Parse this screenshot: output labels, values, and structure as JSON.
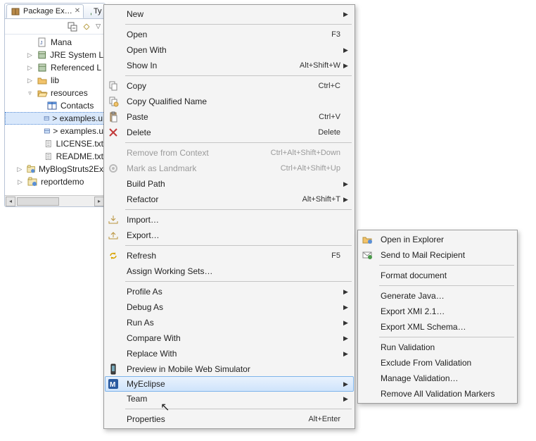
{
  "tabs": {
    "active": "Package Ex…",
    "inactive": "Type Hierar…"
  },
  "tree": {
    "items": [
      {
        "depth": 0,
        "twisty": "",
        "icon": "java-file",
        "label": "Mana"
      },
      {
        "depth": 0,
        "twisty": "▷",
        "icon": "jar",
        "label": "JRE System L"
      },
      {
        "depth": 0,
        "twisty": "▷",
        "icon": "jar",
        "label": "Referenced L"
      },
      {
        "depth": 0,
        "twisty": "▷",
        "icon": "folder",
        "label": "lib"
      },
      {
        "depth": 0,
        "twisty": "▿",
        "icon": "folder-open",
        "label": "resources"
      },
      {
        "depth": 1,
        "twisty": "",
        "icon": "table",
        "label": "Contacts"
      },
      {
        "depth": 1,
        "twisty": "",
        "icon": "uml",
        "label": "> examples.u",
        "selected": true
      },
      {
        "depth": 1,
        "twisty": "",
        "icon": "uml",
        "label": "> examples.u"
      },
      {
        "depth": 1,
        "twisty": "",
        "icon": "text",
        "label": "LICENSE.txt"
      },
      {
        "depth": 1,
        "twisty": "",
        "icon": "text",
        "label": "README.txt"
      },
      {
        "depth": -1,
        "twisty": "▷",
        "icon": "proj",
        "label": "MyBlogStruts2Ex"
      },
      {
        "depth": -1,
        "twisty": "▷",
        "icon": "proj",
        "label": "reportdemo"
      }
    ]
  },
  "menu": [
    {
      "type": "item",
      "label": "New",
      "arrow": true
    },
    {
      "type": "sep"
    },
    {
      "type": "item",
      "label": "Open",
      "shortcut": "F3"
    },
    {
      "type": "item",
      "label": "Open With",
      "arrow": true
    },
    {
      "type": "item",
      "label": "Show In",
      "shortcut": "Alt+Shift+W",
      "arrow": true
    },
    {
      "type": "sep"
    },
    {
      "type": "item",
      "icon": "copy",
      "label": "Copy",
      "shortcut": "Ctrl+C"
    },
    {
      "type": "item",
      "icon": "copy-q",
      "label": "Copy Qualified Name"
    },
    {
      "type": "item",
      "icon": "paste",
      "label": "Paste",
      "shortcut": "Ctrl+V"
    },
    {
      "type": "item",
      "icon": "delete",
      "label": "Delete",
      "shortcut": "Delete"
    },
    {
      "type": "sep"
    },
    {
      "type": "item",
      "disabled": true,
      "label": "Remove from Context",
      "shortcut": "Ctrl+Alt+Shift+Down"
    },
    {
      "type": "item",
      "disabled": true,
      "icon": "landmark",
      "label": "Mark as Landmark",
      "shortcut": "Ctrl+Alt+Shift+Up"
    },
    {
      "type": "item",
      "label": "Build Path",
      "arrow": true
    },
    {
      "type": "item",
      "label": "Refactor",
      "shortcut": "Alt+Shift+T",
      "arrow": true
    },
    {
      "type": "sep"
    },
    {
      "type": "item",
      "icon": "import",
      "label": "Import…"
    },
    {
      "type": "item",
      "icon": "export",
      "label": "Export…"
    },
    {
      "type": "sep"
    },
    {
      "type": "item",
      "icon": "refresh",
      "label": "Refresh",
      "shortcut": "F5"
    },
    {
      "type": "item",
      "label": "Assign Working Sets…"
    },
    {
      "type": "sep"
    },
    {
      "type": "item",
      "label": "Profile As",
      "arrow": true
    },
    {
      "type": "item",
      "label": "Debug As",
      "arrow": true
    },
    {
      "type": "item",
      "label": "Run As",
      "arrow": true
    },
    {
      "type": "item",
      "label": "Compare With",
      "arrow": true
    },
    {
      "type": "item",
      "label": "Replace With",
      "arrow": true
    },
    {
      "type": "item",
      "icon": "mobile",
      "label": "Preview in Mobile Web Simulator"
    },
    {
      "type": "item",
      "icon": "myeclipse",
      "label": "MyEclipse",
      "arrow": true,
      "hover": true
    },
    {
      "type": "item",
      "label": "Team",
      "arrow": true
    },
    {
      "type": "sep"
    },
    {
      "type": "item",
      "label": "Properties",
      "shortcut": "Alt+Enter"
    }
  ],
  "submenu": [
    {
      "type": "item",
      "icon": "explorer",
      "label": "Open in Explorer"
    },
    {
      "type": "item",
      "icon": "mail",
      "label": "Send to Mail Recipient"
    },
    {
      "type": "sep"
    },
    {
      "type": "item",
      "label": "Format document"
    },
    {
      "type": "sep"
    },
    {
      "type": "item",
      "label": "Generate Java…"
    },
    {
      "type": "item",
      "label": "Export XMI 2.1…"
    },
    {
      "type": "item",
      "label": "Export XML Schema…"
    },
    {
      "type": "sep"
    },
    {
      "type": "item",
      "label": "Run Validation"
    },
    {
      "type": "item",
      "label": "Exclude From Validation"
    },
    {
      "type": "item",
      "label": "Manage Validation…"
    },
    {
      "type": "item",
      "label": "Remove All Validation Markers"
    }
  ]
}
